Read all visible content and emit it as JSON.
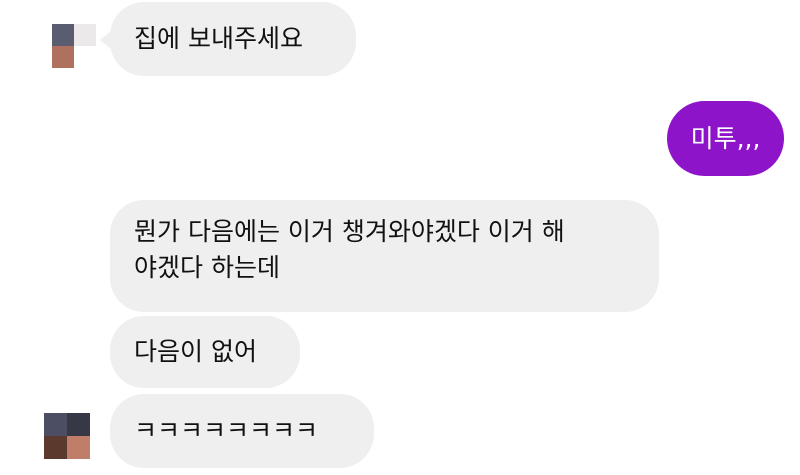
{
  "colors": {
    "incoming_bubble": "#efefef",
    "outgoing_bubble": "#8e14c9",
    "outgoing_text": "#ffffff",
    "incoming_text": "#111111"
  },
  "messages": [
    {
      "side": "incoming",
      "text": "집에 보내주세요"
    },
    {
      "side": "outgoing",
      "text": "미투,,,"
    },
    {
      "side": "incoming",
      "lines": [
        "뭔가 다음에는 이거 챙겨와야겠다 이거 해",
        "야겠다 하는데"
      ]
    },
    {
      "side": "incoming",
      "text": "다음이 없어"
    },
    {
      "side": "incoming",
      "text": "ㅋㅋㅋㅋㅋㅋㅋㅋ"
    }
  ]
}
